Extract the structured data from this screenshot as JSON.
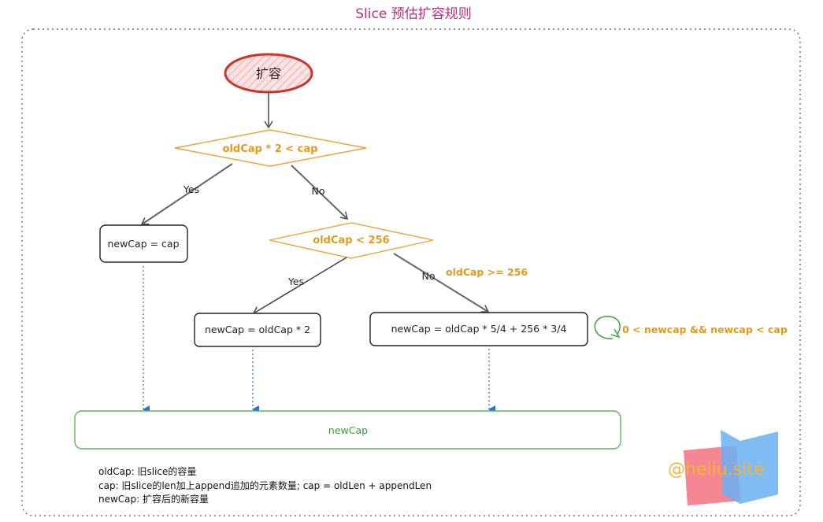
{
  "title": "Slice 预估扩容规则",
  "start": "扩容",
  "decision1": "oldCap * 2 < cap",
  "decision2": "oldCap < 256",
  "branch_yes": "Yes",
  "branch_no": "No",
  "box_newcap_cap": "newCap = cap",
  "box_double": "newCap = oldCap * 2",
  "box_formula": "newCap = oldCap * 5/4 + 256 * 3/4",
  "note_ge256": "oldCap >= 256",
  "loop_condition": "0 < newcap && newcap < cap",
  "result": "newCap",
  "legend": [
    "oldCap: 旧slice的容量",
    "cap: 旧slice的len加上append追加的元素数量; cap = oldLen + appendLen",
    "newCap: 扩容后的新容量"
  ],
  "watermark": "@heliu.site",
  "colors": {
    "title": "#b5317a",
    "decision_stroke": "#e8a43a",
    "decision_text": "#e09a1e",
    "start_stroke": "#c9342c",
    "start_fill": "#f6c9cb",
    "result_stroke": "#5fb35f",
    "result_text": "#3f9a3f",
    "dotted_arrow": "#2f6fbf",
    "frame": "#555555"
  }
}
